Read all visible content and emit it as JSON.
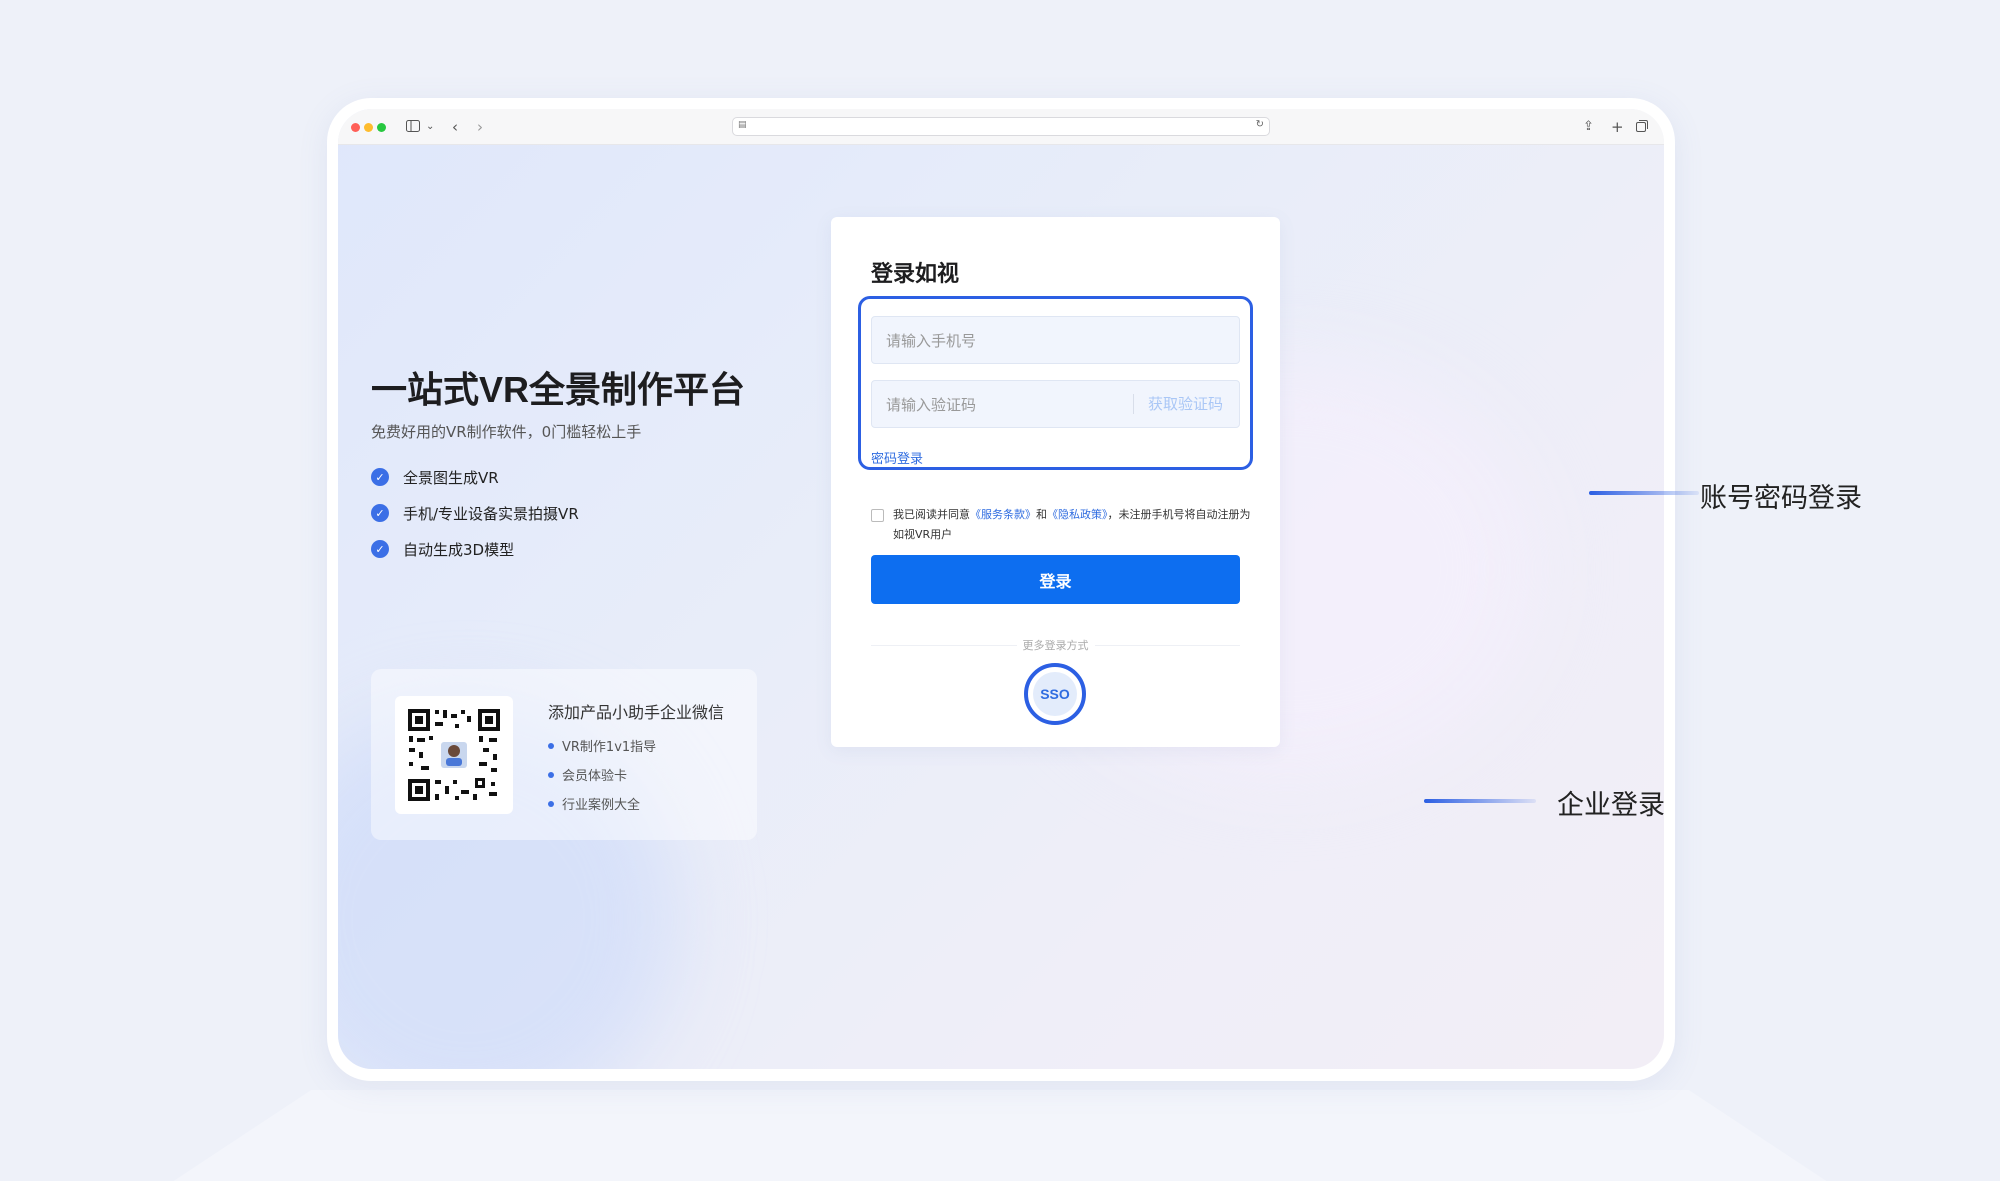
{
  "browser": {
    "traffic_lights": [
      "#ff5f57",
      "#febc2e",
      "#28c840"
    ],
    "icons": [
      "sidebar-icon",
      "chevron-down-icon",
      "back-icon",
      "forward-icon",
      "lock-icon",
      "reload-icon",
      "share-icon",
      "new-tab-icon",
      "tabs-icon"
    ]
  },
  "hero": {
    "title": "一站式VR全景制作平台",
    "subtitle": "免费好用的VR制作软件，0门槛轻松上手",
    "features": [
      "全景图生成VR",
      "手机/专业设备实景拍摄VR",
      "自动生成3D模型"
    ]
  },
  "qr_card": {
    "title": "添加产品小助手企业微信",
    "items": [
      "VR制作1v1指导",
      "会员体验卡",
      "行业案例大全"
    ]
  },
  "login": {
    "title": "登录如视",
    "phone_placeholder": "请输入手机号",
    "code_placeholder": "请输入验证码",
    "get_code_label": "获取验证码",
    "password_login_link": "密码登录",
    "agreement_prefix": "我已阅读并同意",
    "terms_link": "《服务条款》",
    "agreement_and": "和",
    "privacy_link": "《隐私政策》",
    "agreement_suffix": "，未注册手机号将自动注册为如视VR用户",
    "login_button": "登录",
    "more_methods": "更多登录方式",
    "sso_label": "SSO"
  },
  "callouts": {
    "account_login": "账号密码登录",
    "enterprise_login": "企业登录"
  },
  "colors": {
    "accent": "#2c5fe3",
    "primary_button": "#0d6ef0",
    "link": "#2f6ce0"
  }
}
